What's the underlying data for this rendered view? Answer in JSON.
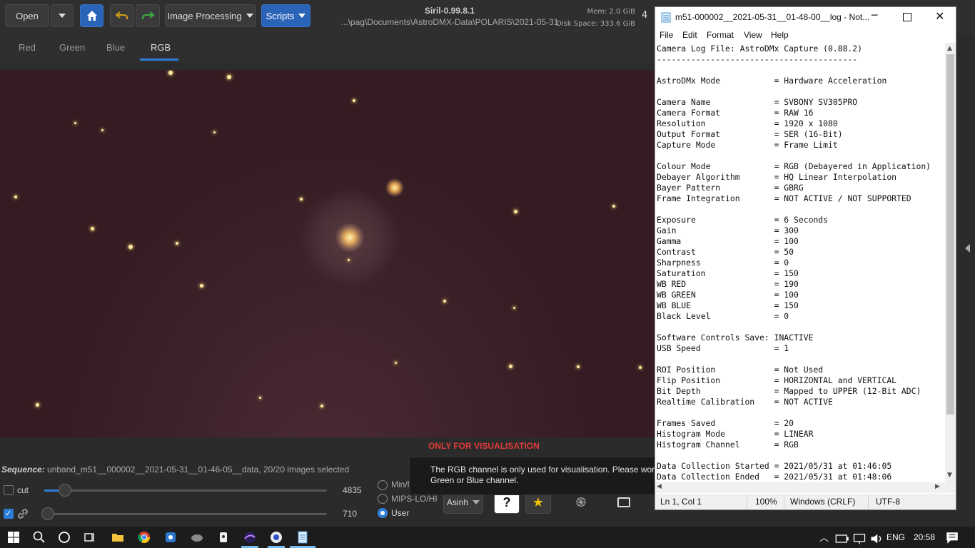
{
  "siril": {
    "open_label": "Open",
    "image_processing_label": "Image Processing",
    "scripts_label": "Scripts",
    "title": "Siril-0.99.8.1",
    "path": "...\\pag\\Documents\\AstroDMX-Data\\POLARIS\\2021-05-31",
    "mem": "Mem: 2.0 GiB",
    "disk": "Disk Space: 333.6 GiB",
    "threads": "4",
    "tabs": [
      "Red",
      "Green",
      "Blue",
      "RGB"
    ],
    "visualisation_warning": "ONLY FOR VISUALISATION",
    "sequence_label": "Sequence:",
    "sequence_value": "unband_m51__000002__2021-05-31__01-46-05__data, 20/20 images selected",
    "cut_label": "cut",
    "hi_value": "4835",
    "lo_value": "710",
    "radio_options": [
      "Min/Max",
      "MIPS-LO/HI",
      "User"
    ],
    "stretch_mode": "Asinh",
    "tooltip": "The RGB channel is only used for visualisation. Please work on the Red, Green or Blue channel."
  },
  "notepad": {
    "title": "m51-000002__2021-05-31__01-48-00__log - Not...",
    "menu": [
      "File",
      "Edit",
      "Format",
      "View",
      "Help"
    ],
    "lines": [
      "Camera Log File: AstroDMx Capture (0.88.2)",
      "-----------------------------------------",
      "",
      "AstroDMx Mode           = Hardware Acceleration",
      "",
      "Camera Name             = SVBONY SV305PRO",
      "Camera Format           = RAW 16",
      "Resolution              = 1920 x 1080",
      "Output Format           = SER (16-Bit)",
      "Capture Mode            = Frame Limit",
      "",
      "Colour Mode             = RGB (Debayered in Application)",
      "Debayer Algorithm       = HQ Linear Interpolation",
      "Bayer Pattern           = GBRG",
      "Frame Integration       = NOT ACTIVE / NOT SUPPORTED",
      "",
      "Exposure                = 6 Seconds",
      "Gain                    = 300",
      "Gamma                   = 100",
      "Contrast                = 50",
      "Sharpness               = 0",
      "Saturation              = 150",
      "WB RED                  = 190",
      "WB GREEN                = 100",
      "WB BLUE                 = 150",
      "Black Level             = 0",
      "",
      "Software Controls Save: INACTIVE",
      "USB Speed               = 1",
      "",
      "ROI Position            = Not Used",
      "Flip Position           = HORIZONTAL and VERTICAL",
      "Bit Depth               = Mapped to UPPER (12-Bit ADC)",
      "Realtime Calibration    = NOT ACTIVE",
      "",
      "Frames Saved            = 20",
      "Histogram Mode          = LINEAR",
      "Histogram Channel       = RGB",
      "",
      "Data Collection Started = 2021/05/31 at 01:46:05",
      "Data Collection Ended   = 2021/05/31 at 01:48:06"
    ],
    "status": {
      "position": "Ln 1, Col 1",
      "zoom": "100%",
      "line_ending": "Windows (CRLF)",
      "encoding": "UTF-8"
    }
  },
  "taskbar": {
    "language": "ENG",
    "time": "20:58"
  },
  "colors": {
    "siril_accent": "#2a64b8",
    "warning_red": "#e03a3a"
  }
}
